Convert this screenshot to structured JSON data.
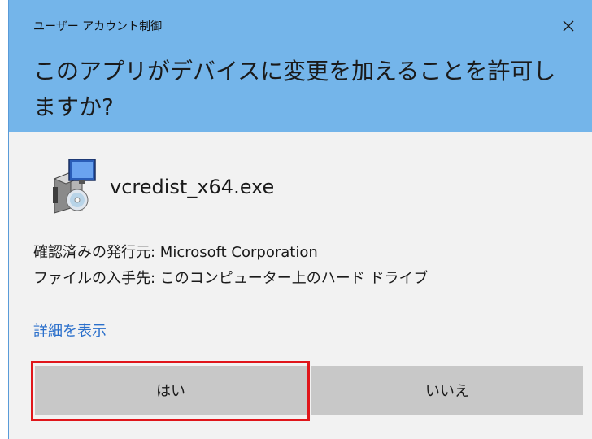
{
  "window": {
    "title": "ユーザー アカウント制御",
    "close_glyph": "✕"
  },
  "prompt": {
    "question": "このアプリがデバイスに変更を加えることを許可しますか?"
  },
  "program": {
    "icon": "installer-package-icon",
    "file_name": "vcredist_x64.exe",
    "publisher_line": "確認済みの発行元: Microsoft Corporation",
    "origin_line": "ファイルの入手先: このコンピューター上のハード ドライブ"
  },
  "links": {
    "show_details": "詳細を表示"
  },
  "buttons": {
    "yes_label": "はい",
    "no_label": "いいえ"
  },
  "colors": {
    "header_bg": "#74b5ea",
    "body_bg": "#f2f2f2",
    "button_bg": "#c8c8c8",
    "link": "#2a6fcb",
    "highlight": "#e0161b"
  }
}
